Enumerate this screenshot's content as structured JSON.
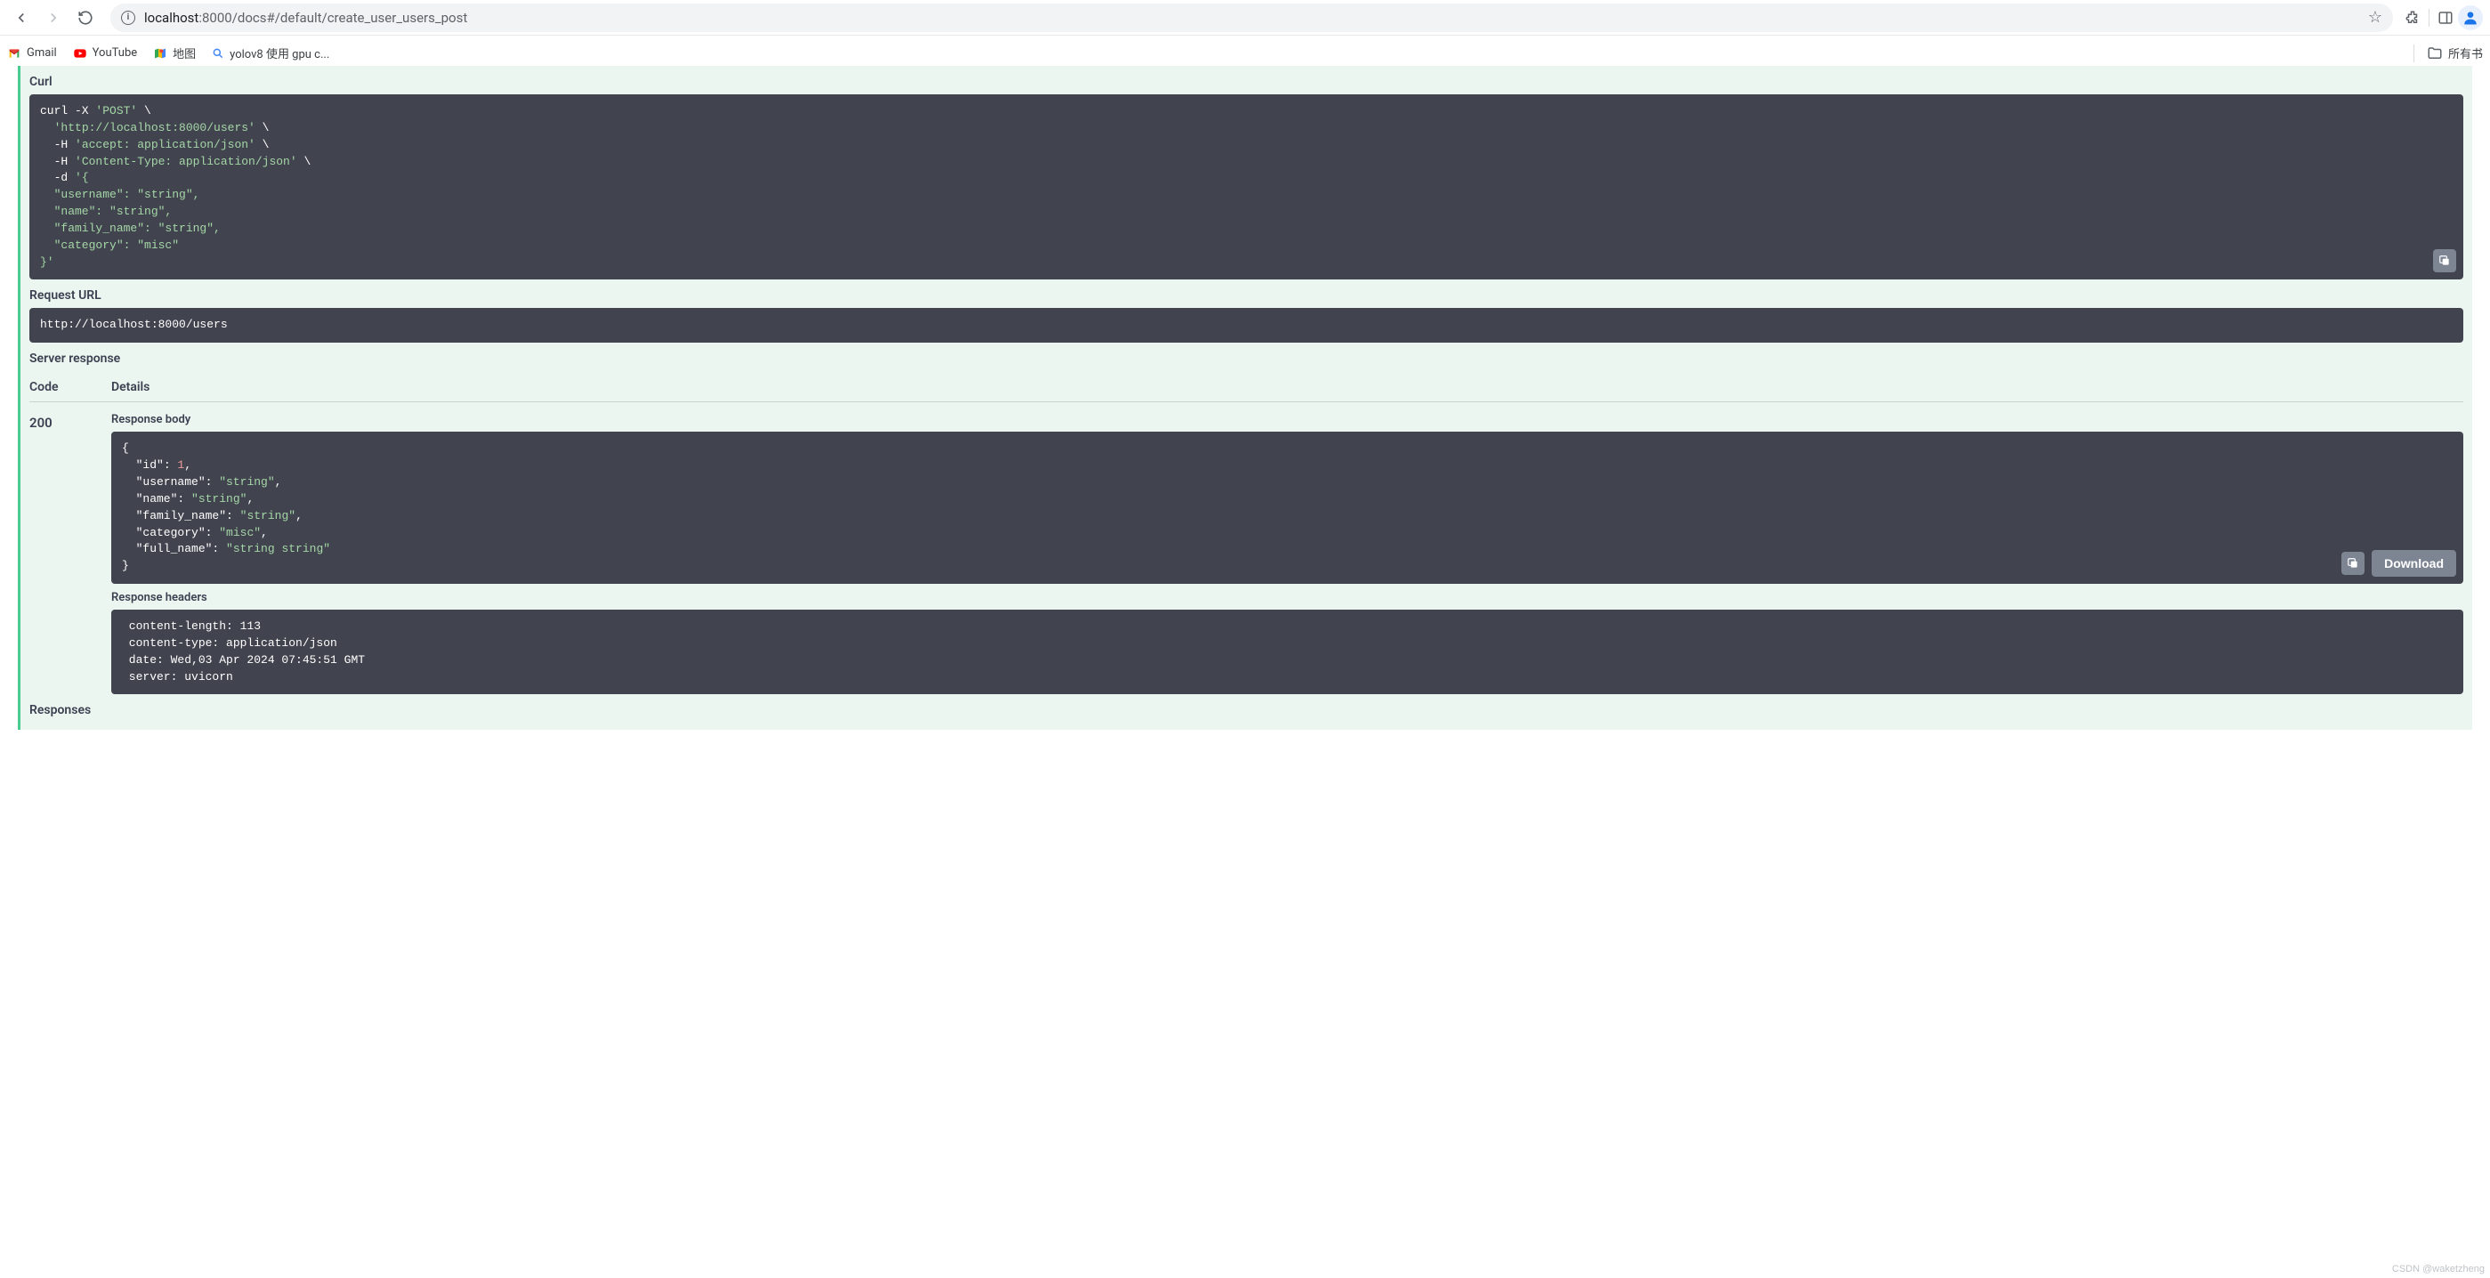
{
  "browser": {
    "url_host": "localhost",
    "url_port": ":8000",
    "url_path": "/docs#/default/create_user_users_post"
  },
  "bookmarks": {
    "gmail": "Gmail",
    "youtube": "YouTube",
    "maps": "地图",
    "search_truncated": "yolov8 使用 gpu c...",
    "all_bookmarks": "所有书"
  },
  "swagger": {
    "curl_label": "Curl",
    "curl_lines": {
      "l1a": "curl -X ",
      "l1b": "'POST'",
      "l1c": " \\",
      "l2a": "  ",
      "l2b": "'http://localhost:8000/users'",
      "l2c": " \\",
      "l3a": "  -H ",
      "l3b": "'accept: application/json'",
      "l3c": " \\",
      "l4a": "  -H ",
      "l4b": "'Content-Type: application/json'",
      "l4c": " \\",
      "l5a": "  -d ",
      "l5b": "'{",
      "l6": "  \"username\": \"string\",",
      "l7": "  \"name\": \"string\",",
      "l8": "  \"family_name\": \"string\",",
      "l9": "  \"category\": \"misc\"",
      "l10": "}'"
    },
    "request_url_label": "Request URL",
    "request_url": "http://localhost:8000/users",
    "server_response_label": "Server response",
    "code_header": "Code",
    "details_header": "Details",
    "status_code": "200",
    "response_body_label": "Response body",
    "response_body_lines": {
      "l1": "{",
      "l2a": "  \"id\"",
      "l2b": ": ",
      "l2c": "1",
      "l2d": ",",
      "l3a": "  \"username\"",
      "l3b": ": ",
      "l3c": "\"string\"",
      "l3d": ",",
      "l4a": "  \"name\"",
      "l4b": ": ",
      "l4c": "\"string\"",
      "l4d": ",",
      "l5a": "  \"family_name\"",
      "l5b": ": ",
      "l5c": "\"string\"",
      "l5d": ",",
      "l6a": "  \"category\"",
      "l6b": ": ",
      "l6c": "\"misc\"",
      "l6d": ",",
      "l7a": "  \"full_name\"",
      "l7b": ": ",
      "l7c": "\"string string\"",
      "l8": "}"
    },
    "download_label": "Download",
    "response_headers_label": "Response headers",
    "response_headers_lines": {
      "l1": " content-length: 113 ",
      "l2": " content-type: application/json ",
      "l3": " date: Wed,03 Apr 2024 07:45:51 GMT ",
      "l4": " server: uvicorn "
    },
    "responses_label": "Responses"
  },
  "watermark": "CSDN @waketzheng"
}
